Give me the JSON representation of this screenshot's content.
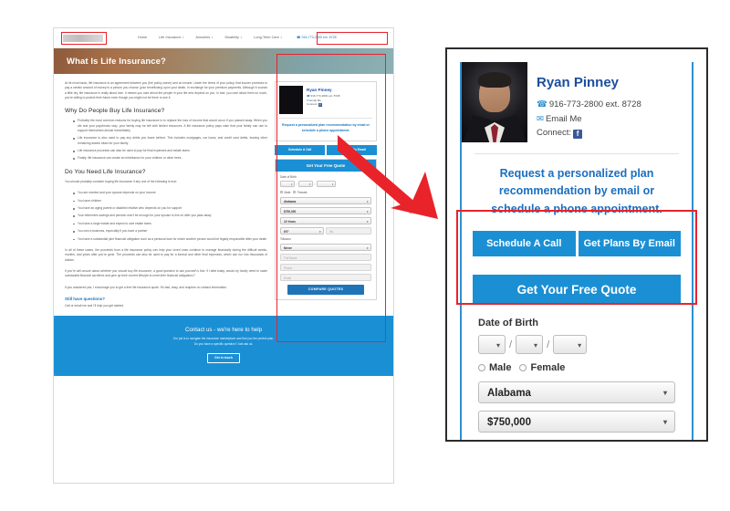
{
  "site": {
    "nav": {
      "logo_alt": "pinney-logo",
      "links": [
        {
          "label": "Home",
          "caret": ""
        },
        {
          "label": "Life Insurance",
          "caret": "▾"
        },
        {
          "label": "Annuities",
          "caret": "▾"
        },
        {
          "label": "Disability",
          "caret": "▾"
        },
        {
          "label": "Long-Term Care",
          "caret": "▾"
        }
      ],
      "phone": "☎ 916-773-2800 ext. 8728"
    },
    "hero_title": "What Is Life Insurance?"
  },
  "article": {
    "intro": "At its most basic, life insurance is an agreement between you (the policy owner) and an insurer. Under the terms of your policy, that insurer promises to pay a certain amount of money to a person you choose (your beneficiary) upon your death, in exchange for your premium payments. Although it sounds a little dry, life insurance is really about love. It means you care about the people in your life who depend on you. In fact, you care about them so much, you're willing to protect their future even though you might not be there to see it.",
    "h2_why": "Why Do People Buy Life Insurance?",
    "why_bullets": [
      "Probably the most common reasons for buying life insurance is to replace the loss of income that would occur if you passed away. When you die and your paychecks stop, your family may be left with limited resources. A life insurance policy pays cash that your family can use to support themselves almost immediately.",
      "Life insurance is also used to pay any debts you leave behind. This includes mortgages, car loans, and credit card debts, leaving other remaining assets intact for your family.",
      "Life insurance proceeds can also be used to pay for final expenses and estate taxes.",
      "Finally, life insurance can create an inheritance for your children or other heirs."
    ],
    "h2_need": "Do You Need Life Insurance?",
    "need_intro": "You should probably consider buying life insurance if any one of the following is true:",
    "need_bullets": [
      "You are married and your spouse depends on your income",
      "You have children",
      "You have an aging parent or disabled relative who depends on you for support",
      "Your retirement savings and pension won't be enough for your spouse to live on after you pass away",
      "You have a large estate and expect to owe estate taxes",
      "You own a business, especially if you have a partner",
      "You have a substantial joint financial obligation such as a personal loan for which another person would be legally responsible after your death"
    ],
    "para_proceeds": "In all of these cases, the proceeds from a life insurance policy can help your loved ones continue to manage financially during the difficult weeks, months, and years after you're gone. The proceeds can also be used to pay for a funeral and other final expenses, which can run into thousands of dollars.",
    "para_unsure": "If you're still unsure about whether you should buy life insurance, a good question to ask yourself is this: if I died today, would my family need to make substantial financial sacrifices and give up their current lifestyle to meet their financial obligations?",
    "para_answer": "If you answered yes, I encourage you to get a free life insurance quote. It's fast, easy, and requires no contact information.",
    "h3_questions": "Still have questions?",
    "questions_sub": "Call or email me and I'll help you get started."
  },
  "agent": {
    "name": "Ryan Pinney",
    "phone": "916-773-2800 ext. 8728",
    "phone_icon": "☎",
    "email_label": "Email Me",
    "email_icon": "✉",
    "connect_label": "Connect:",
    "facebook_glyph": "f",
    "cta": "Request a personalized plan recommendation by email or schedule a phone appointment.",
    "photo_alt": "agent-headshot"
  },
  "cta_buttons": {
    "schedule": "Schedule A Call",
    "email_plans": "Get Plans By Email",
    "free_quote": "Get Your Free Quote"
  },
  "quote_form": {
    "header": "Get Your Free Quote",
    "dob_label": "Date of Birth",
    "dob_month": "",
    "dob_day": "",
    "dob_year": "",
    "gender": {
      "male": "Male",
      "female": "Female"
    },
    "state": "Alabama",
    "coverage": "$750,000",
    "term": "10 Years",
    "height": "6'0\"",
    "weight_placeholder": "lbs.",
    "tobacco_label": "Tobacco",
    "tobacco": "Never",
    "full_name_placeholder": "Full Name",
    "phone_placeholder": "Phone",
    "email_placeholder": "Email",
    "submit": "COMPARE QUOTES"
  },
  "footer": {
    "title": "Contact us - we're here to help",
    "line1": "Our job is to navigate the insurance marketplace and find you the perfect plan.",
    "line2": "Do you have a specific question? Just ask us.",
    "button": "Get in touch"
  },
  "colors": {
    "brand_blue": "#1b8fd4",
    "dark_blue": "#1b4f9c",
    "annotation_red": "#e8232a"
  }
}
